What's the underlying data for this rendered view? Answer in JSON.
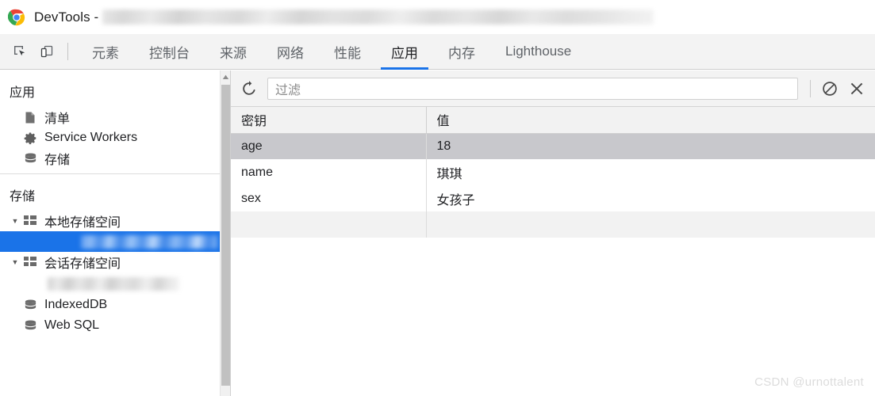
{
  "window": {
    "app_name": "DevTools",
    "title_text": "DevTools -",
    "url_redacted": true,
    "chrome_logo_icon": "chrome-logo-icon"
  },
  "toolbar": {
    "inspect_icon": "inspect-element-icon",
    "device_toolbar_icon": "device-toolbar-icon"
  },
  "tabs": [
    {
      "label": "元素",
      "active": false
    },
    {
      "label": "控制台",
      "active": false
    },
    {
      "label": "来源",
      "active": false
    },
    {
      "label": "网络",
      "active": false
    },
    {
      "label": "性能",
      "active": false
    },
    {
      "label": "应用",
      "active": true
    },
    {
      "label": "内存",
      "active": false
    },
    {
      "label": "Lighthouse",
      "active": false
    }
  ],
  "accent_color": "#1a73e8",
  "sidebar": {
    "sections": [
      {
        "title": "应用",
        "items": [
          {
            "label": "清单",
            "icon": "manifest-document-icon",
            "indent": 1,
            "selected": false
          },
          {
            "label": "Service Workers",
            "icon": "gear-icon",
            "indent": 1,
            "selected": false
          },
          {
            "label": "存储",
            "icon": "database-icon",
            "indent": 1,
            "selected": false
          }
        ]
      },
      {
        "title": "存储",
        "items": [
          {
            "label": "本地存储空间",
            "icon": "grid-table-icon",
            "indent": 0,
            "expanded": true,
            "selected": false
          },
          {
            "label": "",
            "icon": "",
            "indent": 2,
            "selected": true,
            "redacted": true
          },
          {
            "label": "会话存储空间",
            "icon": "grid-table-icon",
            "indent": 0,
            "expanded": true,
            "selected": false
          },
          {
            "label": "",
            "icon": "",
            "indent": 2,
            "selected": false,
            "redacted": true
          },
          {
            "label": "IndexedDB",
            "icon": "database-icon",
            "indent": 1,
            "selected": false
          },
          {
            "label": "Web SQL",
            "icon": "database-icon",
            "indent": 1,
            "selected": false
          }
        ]
      }
    ],
    "scrollbar": {
      "visible": true,
      "up_arrow_icon": "scroll-up-arrow-icon"
    }
  },
  "panel": {
    "refresh_icon": "refresh-icon",
    "clear_all_icon": "clear-all-icon",
    "delete_selected_icon": "delete-selected-icon",
    "filter": {
      "placeholder": "过滤",
      "value": ""
    },
    "table": {
      "columns": [
        "密钥",
        "值"
      ],
      "rows": [
        {
          "key": "age",
          "value": "18",
          "selected": true
        },
        {
          "key": "name",
          "value": "琪琪",
          "selected": false
        },
        {
          "key": "sex",
          "value": "女孩子",
          "selected": false
        },
        {
          "key": "",
          "value": "",
          "selected": false,
          "empty": true
        }
      ]
    }
  },
  "watermark": {
    "text": "CSDN @urnottalent"
  }
}
